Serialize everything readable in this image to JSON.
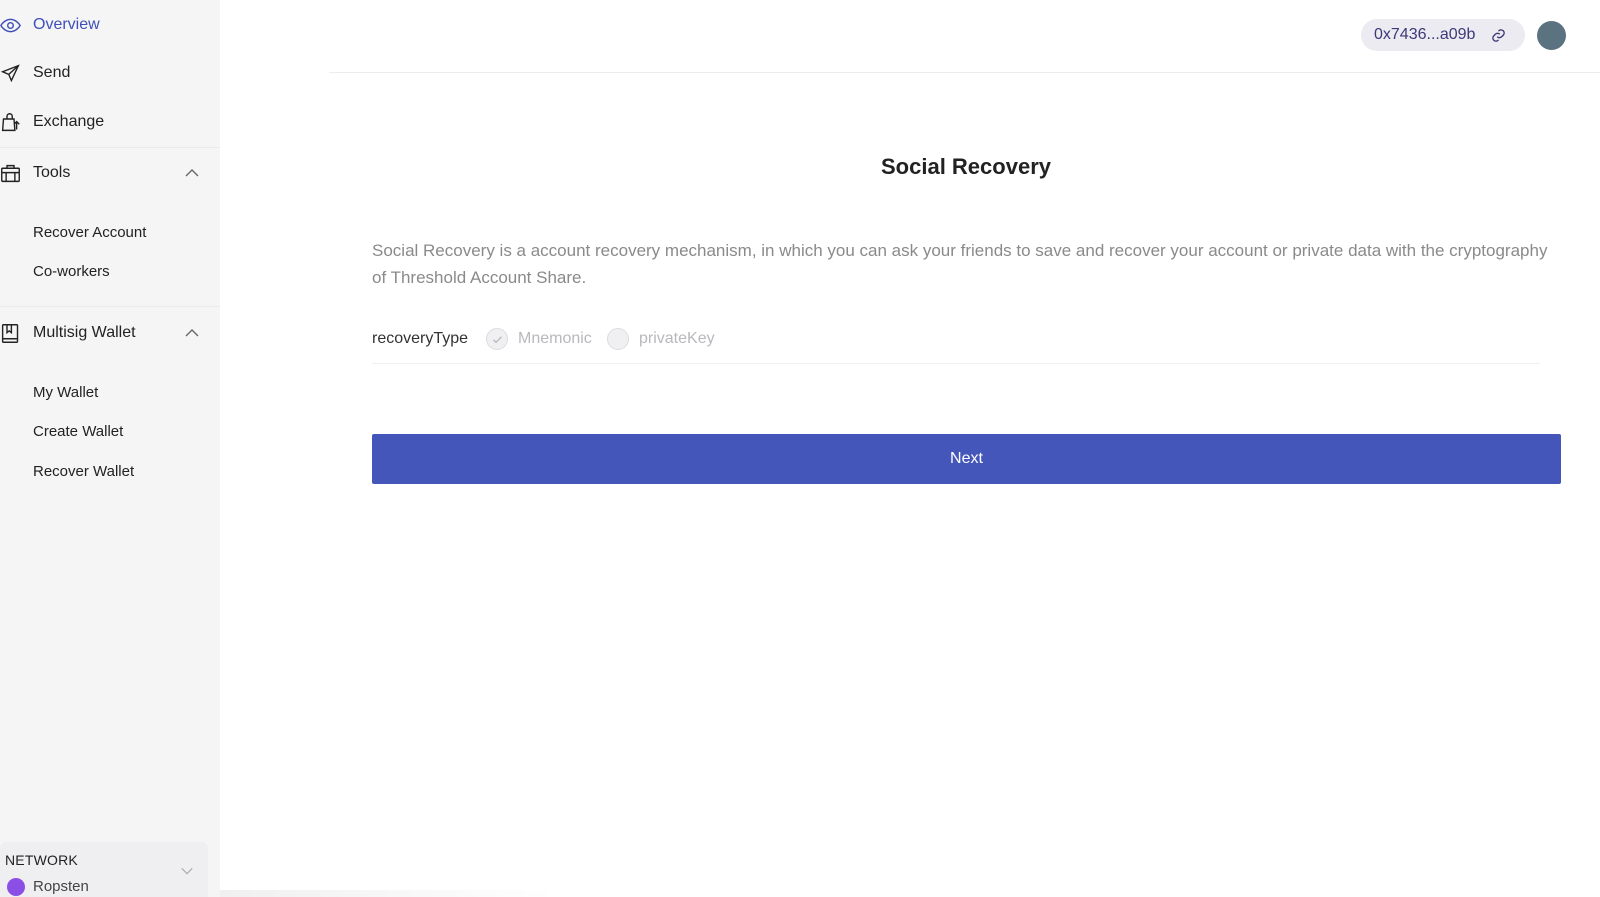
{
  "sidebar": {
    "nav": [
      {
        "label": "Overview",
        "icon": "eye-icon",
        "active": true
      },
      {
        "label": "Send",
        "icon": "send-icon"
      },
      {
        "label": "Exchange",
        "icon": "exchange-icon"
      },
      {
        "label": "Tools",
        "icon": "toolbox-icon",
        "expanded": true
      },
      {
        "label": "Multisig Wallet",
        "icon": "wallet-icon",
        "expanded": true
      }
    ],
    "tools_items": [
      "Recover Account",
      "Co-workers"
    ],
    "multisig_items": [
      "My Wallet",
      "Create Wallet",
      "Recover Wallet"
    ],
    "network": {
      "title": "NETWORK",
      "name": "Ropsten",
      "dot_color": "#8b4fe6"
    }
  },
  "header": {
    "address": "0x7436...a09b",
    "avatar_color": "#5b7280"
  },
  "main": {
    "title": "Social Recovery",
    "description": "Social Recovery is a account recovery mechanism, in which you can ask your friends to save and recover your account or private data with the cryptography of Threshold Account Share.",
    "form": {
      "label": "recoveryType",
      "options": [
        "Mnemonic",
        "privateKey"
      ],
      "selected": "Mnemonic"
    },
    "next_button": "Next"
  },
  "colors": {
    "accent": "#4556bb",
    "active_nav": "#3f4fb8",
    "sidebar_bg": "#f5f5f6"
  }
}
